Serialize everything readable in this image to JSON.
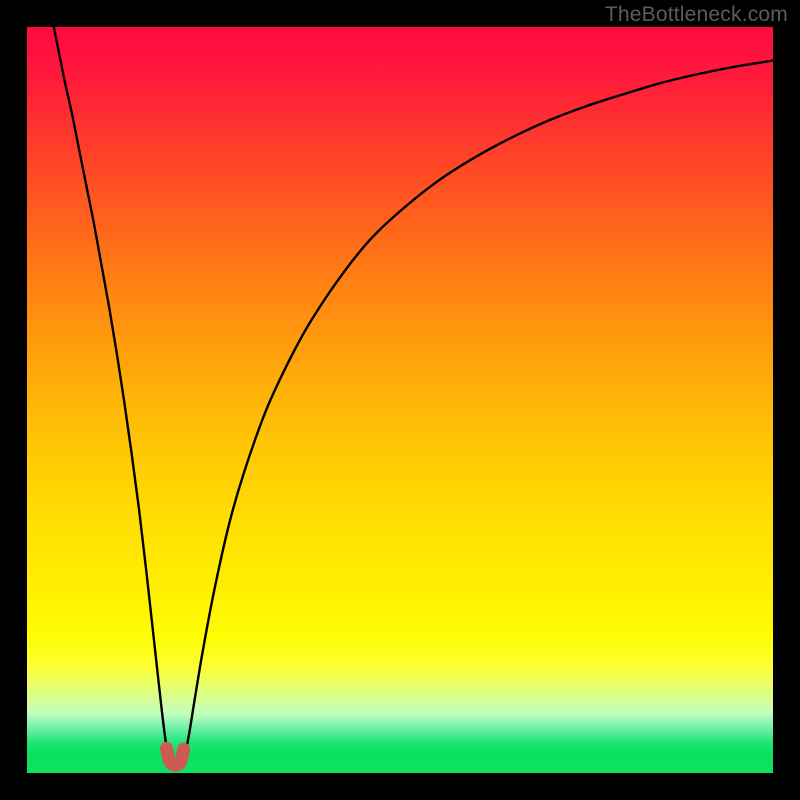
{
  "watermark": {
    "text": "TheBottleneck.com"
  },
  "chart_data": {
    "type": "line",
    "title": "",
    "xlabel": "",
    "ylabel": "",
    "xlim": [
      0,
      100
    ],
    "ylim": [
      0,
      100
    ],
    "grid": false,
    "legend": false,
    "background_gradient": {
      "stops": [
        {
          "pos": 0.0,
          "color": "#ff0a42"
        },
        {
          "pos": 0.07,
          "color": "#ff1b3a"
        },
        {
          "pos": 0.2,
          "color": "#ff4c24"
        },
        {
          "pos": 0.35,
          "color": "#ff8312"
        },
        {
          "pos": 0.5,
          "color": "#ffb506"
        },
        {
          "pos": 0.65,
          "color": "#ffdc02"
        },
        {
          "pos": 0.78,
          "color": "#fff402"
        },
        {
          "pos": 0.82,
          "color": "#fffd04"
        },
        {
          "pos": 0.86,
          "color": "#fbff3a"
        },
        {
          "pos": 0.89,
          "color": "#e0ff7a"
        },
        {
          "pos": 0.92,
          "color": "#c1febe"
        },
        {
          "pos": 0.94,
          "color": "#6fefa7"
        },
        {
          "pos": 0.96,
          "color": "#1de573"
        },
        {
          "pos": 0.975,
          "color": "#0ae15e"
        },
        {
          "pos": 1.0,
          "color": "#0de25f"
        }
      ]
    },
    "series": [
      {
        "name": "bottleneck-curve",
        "stroke": "#000000",
        "stroke_width": 2.4,
        "x": [
          3.6,
          5,
          6,
          7,
          8,
          9,
          10,
          11,
          12,
          13,
          14,
          15,
          16,
          17,
          18,
          18.7,
          19.3,
          20,
          20.7,
          21.5,
          22.5,
          23.5,
          25,
          27,
          29,
          32,
          35,
          38,
          42,
          46,
          50,
          55,
          60,
          65,
          70,
          75,
          80,
          85,
          90,
          95,
          100
        ],
        "y": [
          100,
          93,
          88.5,
          83.5,
          78.5,
          73.5,
          68,
          62.5,
          56.5,
          50,
          43,
          35.5,
          27,
          18,
          9,
          3.5,
          1.4,
          1.2,
          1.6,
          4,
          10,
          16,
          24,
          33,
          40,
          48.5,
          55,
          60.5,
          66.5,
          71.5,
          75.3,
          79.3,
          82.5,
          85.2,
          87.5,
          89.4,
          91,
          92.5,
          93.7,
          94.7,
          95.5
        ]
      },
      {
        "name": "valley-marker",
        "stroke": "#cc5b55",
        "stroke_width": 13,
        "linecap": "round",
        "x": [
          18.7,
          19.1,
          19.6,
          20.1,
          20.6,
          21.0
        ],
        "y": [
          3.3,
          1.6,
          1.1,
          1.1,
          1.5,
          3.2
        ]
      }
    ]
  }
}
